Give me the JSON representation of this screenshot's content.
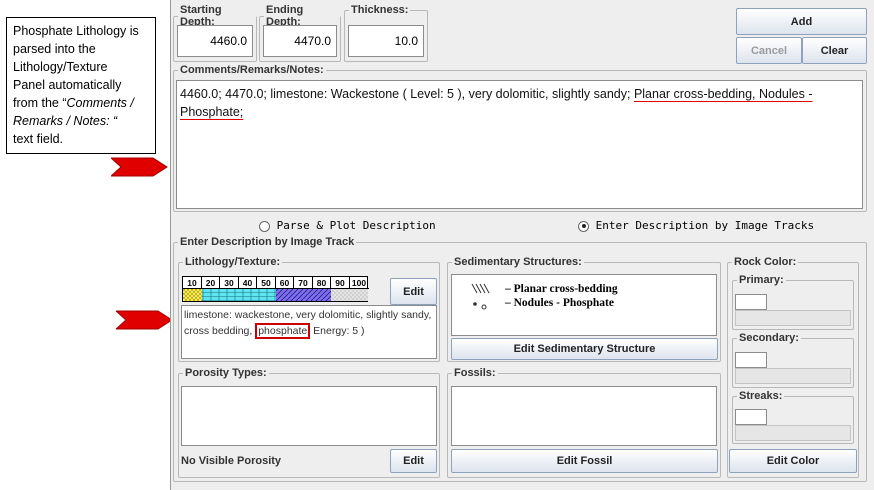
{
  "callout": {
    "line1": "Phosphate Lithology is",
    "line2": "parsed into the",
    "line3": "Lithology/Texture",
    "line4": "Panel automatically",
    "line5": "from the “",
    "line5_italic": "Comments /",
    "line6_italic": "Remarks / Notes: “",
    "line7": "text field."
  },
  "depth": {
    "start_label": "Starting Depth:",
    "start_value": "4460.0",
    "end_label": "Ending Depth:",
    "end_value": "4470.0",
    "thickness_label": "Thickness:",
    "thickness_value": "10.0"
  },
  "buttons": {
    "add": "Add",
    "cancel": "Cancel",
    "clear": "Clear",
    "edit_lith": "Edit",
    "edit_sed": "Edit Sedimentary Structure",
    "edit_por": "Edit",
    "edit_fossil": "Edit Fossil",
    "edit_color": "Edit Color"
  },
  "comments": {
    "label": "Comments/Remarks/Notes:",
    "text_part1": "4460.0; 4470.0; limestone: Wackestone ( Level: 5 ), very dolomitic, slightly sandy; ",
    "text_underlined1": "Planar cross-bedding, Nodules -",
    "text_underlined2": "Phosphate;"
  },
  "mode": {
    "parse_label": "Parse & Plot Description",
    "image_label": "Enter Description by Image Tracks",
    "selected": "image"
  },
  "image_track": {
    "label": "Enter Description by Image Track",
    "lithology": {
      "label": "Lithology/Texture:",
      "scale": [
        "10",
        "20",
        "30",
        "40",
        "50",
        "60",
        "70",
        "80",
        "90",
        "100"
      ],
      "desc_part1": "limestone:  wackestone, very dolomitic, slightly sandy,",
      "desc_part2": "cross bedding, ",
      "desc_highlight": "phosphate",
      "desc_part3": "  Energy: 5 )"
    },
    "sedimentary": {
      "label": "Sedimentary Structures:",
      "items": [
        "– Planar cross-bedding",
        "– Nodules - Phosphate"
      ]
    },
    "rock_color": {
      "label": "Rock Color:",
      "primary": "Primary:",
      "secondary": "Secondary:",
      "streaks": "Streaks:"
    },
    "porosity": {
      "label": "Porosity Types:",
      "status": "No Visible Porosity"
    },
    "fossils": {
      "label": "Fossils:"
    }
  },
  "colors": {
    "arrow": "#e00000",
    "underline": "#e00000",
    "highlight_box": "#cc0000",
    "button_border": "#8ea2bc",
    "panel_bg": "#eeeeee"
  }
}
